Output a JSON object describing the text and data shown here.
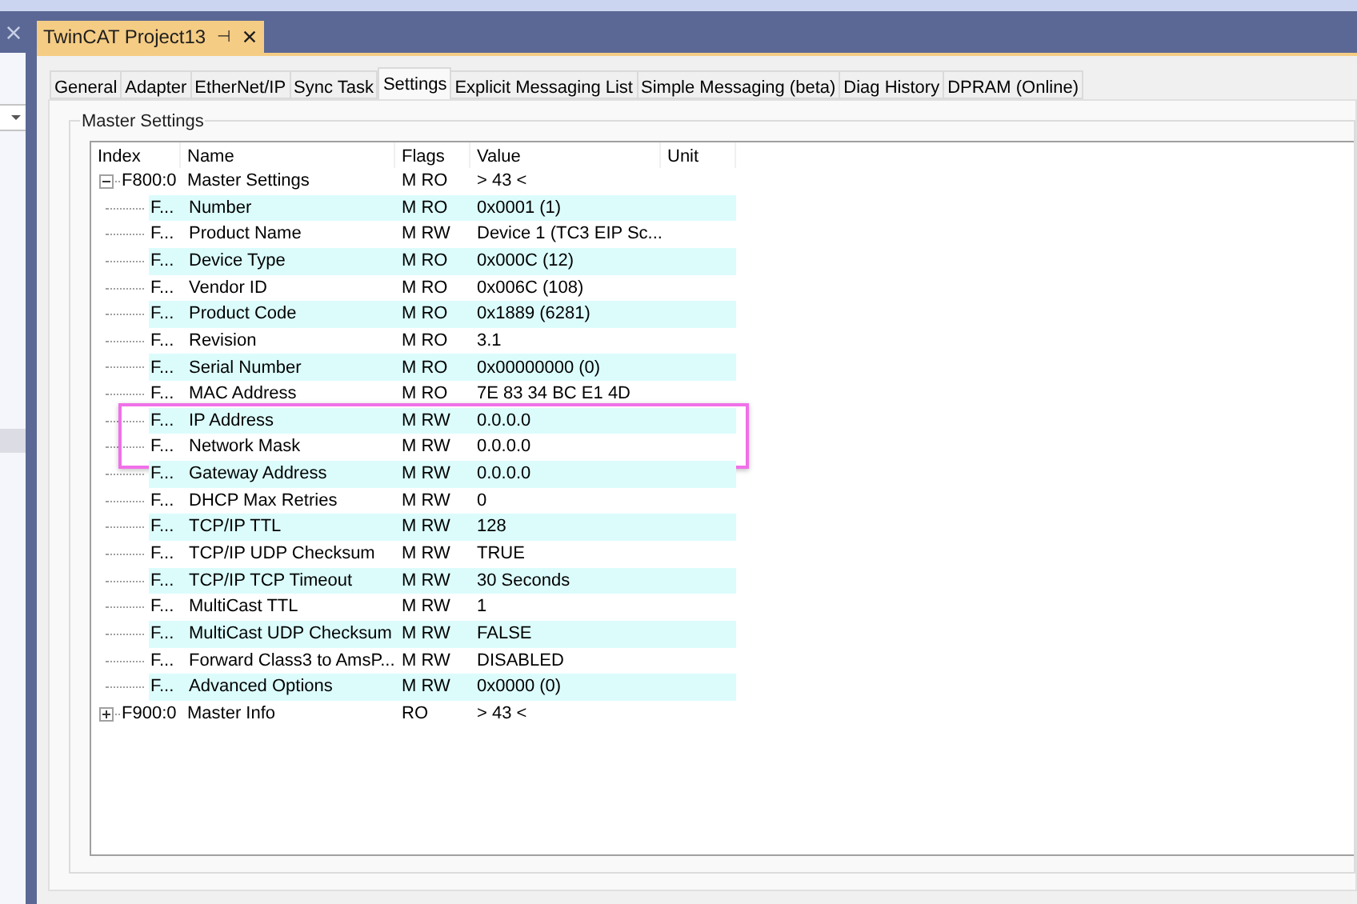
{
  "document_tab": {
    "title": "TwinCAT Project13",
    "pin": "⊣"
  },
  "tabs": [
    {
      "label": "General",
      "selected": false
    },
    {
      "label": "Adapter",
      "selected": false
    },
    {
      "label": "EtherNet/IP",
      "selected": false
    },
    {
      "label": "Sync Task",
      "selected": false
    },
    {
      "label": "Settings",
      "selected": true
    },
    {
      "label": "Explicit Messaging List",
      "selected": false
    },
    {
      "label": "Simple Messaging (beta)",
      "selected": false
    },
    {
      "label": "Diag History",
      "selected": false
    },
    {
      "label": "DPRAM (Online)",
      "selected": false
    }
  ],
  "group": {
    "title": "Master Settings"
  },
  "table": {
    "columns": [
      "Index",
      "Name",
      "Flags",
      "Value",
      "Unit"
    ],
    "rows": [
      {
        "index": "F800:0",
        "name": "Master Settings",
        "flags": "M RO",
        "value": "> 43 <",
        "expanded": true,
        "children": [
          {
            "index": "F...",
            "name": "Number",
            "flags": "M RO",
            "value": "0x0001 (1)",
            "outlined": false
          },
          {
            "index": "F...",
            "name": "Product Name",
            "flags": "M RW",
            "value": "Device 1 (TC3 EIP Sc...",
            "outlined": false
          },
          {
            "index": "F...",
            "name": "Device Type",
            "flags": "M RO",
            "value": "0x000C (12)",
            "outlined": false
          },
          {
            "index": "F...",
            "name": "Vendor ID",
            "flags": "M RO",
            "value": "0x006C (108)",
            "outlined": false
          },
          {
            "index": "F...",
            "name": "Product Code",
            "flags": "M RO",
            "value": "0x1889 (6281)",
            "outlined": false
          },
          {
            "index": "F...",
            "name": "Revision",
            "flags": "M RO",
            "value": "3.1",
            "outlined": false
          },
          {
            "index": "F...",
            "name": "Serial Number",
            "flags": "M RO",
            "value": "0x00000000 (0)",
            "outlined": false
          },
          {
            "index": "F...",
            "name": "MAC Address",
            "flags": "M RO",
            "value": "7E 83 34 BC E1 4D",
            "outlined": false
          },
          {
            "index": "F...",
            "name": "IP Address",
            "flags": "M RW",
            "value": "0.0.0.0",
            "outlined": true
          },
          {
            "index": "F...",
            "name": "Network Mask",
            "flags": "M RW",
            "value": "0.0.0.0",
            "outlined": true
          },
          {
            "index": "F...",
            "name": "Gateway Address",
            "flags": "M RW",
            "value": "0.0.0.0",
            "outlined": false
          },
          {
            "index": "F...",
            "name": "DHCP Max Retries",
            "flags": "M RW",
            "value": "0",
            "outlined": false
          },
          {
            "index": "F...",
            "name": "TCP/IP TTL",
            "flags": "M RW",
            "value": "128",
            "outlined": false
          },
          {
            "index": "F...",
            "name": "TCP/IP UDP Checksum",
            "flags": "M RW",
            "value": "TRUE",
            "outlined": false
          },
          {
            "index": "F...",
            "name": "TCP/IP TCP Timeout",
            "flags": "M RW",
            "value": "30 Seconds",
            "outlined": false
          },
          {
            "index": "F...",
            "name": "MultiCast TTL",
            "flags": "M RW",
            "value": "1",
            "outlined": false
          },
          {
            "index": "F...",
            "name": "MultiCast UDP Checksum",
            "flags": "M RW",
            "value": "FALSE",
            "outlined": false
          },
          {
            "index": "F...",
            "name": "Forward Class3 to AmsP...",
            "flags": "M RW",
            "value": "DISABLED",
            "outlined": false
          },
          {
            "index": "F...",
            "name": "Advanced Options",
            "flags": "M RW",
            "value": "0x0000 (0)",
            "outlined": false
          }
        ]
      },
      {
        "index": "F900:0",
        "name": "Master Info",
        "flags": "RO",
        "value": "> 43 <",
        "expanded": false,
        "children": []
      }
    ]
  }
}
